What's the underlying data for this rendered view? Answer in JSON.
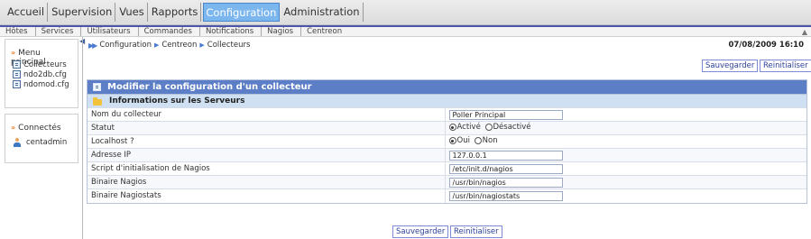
{
  "topnav": [
    {
      "label": "Accueil",
      "active": false
    },
    {
      "label": "Supervision",
      "active": false
    },
    {
      "label": "Vues",
      "active": false
    },
    {
      "label": "Rapports",
      "active": false
    },
    {
      "label": "Configuration",
      "active": true
    },
    {
      "label": "Administration",
      "active": false
    }
  ],
  "subnav": [
    "Hôtes",
    "Services",
    "Utilisateurs",
    "Commandes",
    "Notifications",
    "Nagios",
    "Centreon"
  ],
  "menu_panel": {
    "title": "Menu principal",
    "items": [
      "Collecteurs",
      "ndo2db.cfg",
      "ndomod.cfg"
    ]
  },
  "connected_panel": {
    "title": "Connectés",
    "user": "centadmin"
  },
  "breadcrumb": [
    "Configuration",
    "Centreon",
    "Collecteurs"
  ],
  "datetime": "07/08/2009 16:10",
  "buttons": {
    "save": "Sauvegarder",
    "reset": "Reinitialiser",
    "reset_bottom": "Reinitialiser"
  },
  "form": {
    "title": "Modifier la configuration d'un collecteur",
    "section": "Informations sur les Serveurs",
    "rows": [
      {
        "label": "Nom du collecteur",
        "value": "Poller Principal"
      },
      {
        "label": "Statut",
        "options": [
          "Activé",
          "Désactivé"
        ],
        "selected": "Activé"
      },
      {
        "label": "Localhost ?",
        "options": [
          "Oui",
          "Non"
        ],
        "selected": "Oui"
      },
      {
        "label": "Adresse IP",
        "value": "127.0.0.1"
      },
      {
        "label": "Script d'initialisation de Nagios",
        "value": "/etc/init.d/nagios"
      },
      {
        "label": "Binaire Nagios",
        "value": "/usr/bin/nagios"
      },
      {
        "label": "Binaire Nagiostats",
        "value": "/usr/bin/nagiostats"
      }
    ]
  },
  "colors": {
    "accent": "#4d55a8",
    "active_tab": "#7bb6ee",
    "form_header": "#5b7ec6",
    "section_header": "#cfe0f2",
    "button_text": "#2c3f9c"
  }
}
